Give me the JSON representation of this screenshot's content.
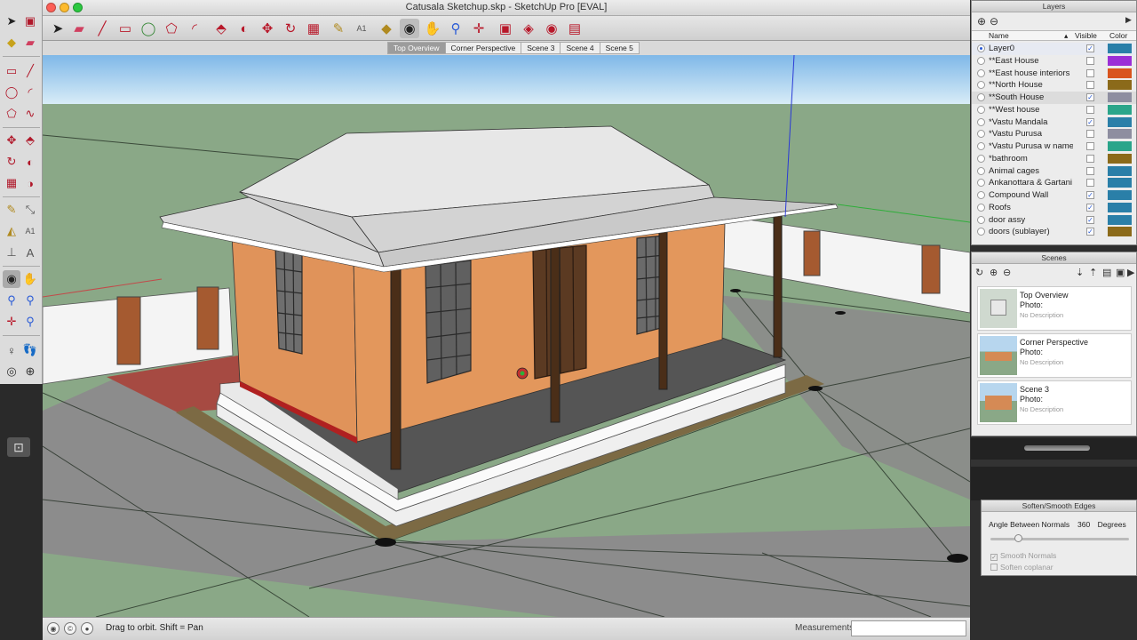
{
  "window": {
    "title": "Catusala Sketchup.skp - SketchUp Pro [EVAL]"
  },
  "scene_tabs": [
    {
      "label": "Top Overview",
      "active": true
    },
    {
      "label": "Corner Perspective",
      "active": false
    },
    {
      "label": "Scene 3",
      "active": false
    },
    {
      "label": "Scene 4",
      "active": false
    },
    {
      "label": "Scene 5",
      "active": false
    }
  ],
  "layers_panel": {
    "title": "Layers",
    "col_name": "Name",
    "col_visible": "Visible",
    "col_color": "Color",
    "rows": [
      {
        "name": "Layer0",
        "active": true,
        "visible": true,
        "color": "#2a7fa8"
      },
      {
        "name": "**East House",
        "active": false,
        "visible": false,
        "color": "#9b2fd6"
      },
      {
        "name": "**East house interiors",
        "active": false,
        "visible": false,
        "color": "#d9541e"
      },
      {
        "name": "**North House",
        "active": false,
        "visible": false,
        "color": "#8b6a1a"
      },
      {
        "name": "**South House",
        "active": false,
        "visible": true,
        "color": "#8e8ea0"
      },
      {
        "name": "**West house",
        "active": false,
        "visible": false,
        "color": "#2aa58a"
      },
      {
        "name": "*Vastu Mandala",
        "active": false,
        "visible": true,
        "color": "#2a7fa8"
      },
      {
        "name": "*Vastu Purusa",
        "active": false,
        "visible": false,
        "color": "#8e8ea0"
      },
      {
        "name": "*Vastu Purusa w name",
        "active": false,
        "visible": false,
        "color": "#2aa58a"
      },
      {
        "name": "*bathroom",
        "active": false,
        "visible": false,
        "color": "#8b6a1a"
      },
      {
        "name": "Animal cages",
        "active": false,
        "visible": false,
        "color": "#2a7fa8"
      },
      {
        "name": "Ankanottara & Gartani",
        "active": false,
        "visible": false,
        "color": "#2a7fa8"
      },
      {
        "name": "Compound Wall",
        "active": false,
        "visible": true,
        "color": "#2a7fa8"
      },
      {
        "name": "Roofs",
        "active": false,
        "visible": true,
        "color": "#2a7fa8"
      },
      {
        "name": "door assy",
        "active": false,
        "visible": true,
        "color": "#2a7fa8"
      },
      {
        "name": "doors (sublayer)",
        "active": false,
        "visible": true,
        "color": "#8b6a1a"
      }
    ]
  },
  "scenes_panel": {
    "title": "Scenes",
    "items": [
      {
        "name": "Top Overview",
        "photo_label": "Photo:",
        "description": "No Description"
      },
      {
        "name": "Corner Perspective",
        "photo_label": "Photo:",
        "description": "No Description"
      },
      {
        "name": "Scene 3",
        "photo_label": "Photo:",
        "description": "No Description"
      }
    ]
  },
  "soften_panel": {
    "title": "Soften/Smooth Edges",
    "angle_label": "Angle Between Normals",
    "angle_value": "360",
    "angle_unit": "Degrees",
    "slider_value_percent": 20,
    "smooth_normals_label": "Smooth Normals",
    "smooth_normals_checked": true,
    "soften_coplanar_label": "Soften coplanar",
    "soften_coplanar_checked": false
  },
  "statusbar": {
    "hint": "Drag to orbit.  Shift = Pan",
    "measurements_label": "Measurements",
    "measurements_value": ""
  },
  "colors": {
    "sky": "#8ec3ec",
    "ground": "#8aa887",
    "plaster": "#e3975c",
    "accent_red": "#b8182a"
  }
}
